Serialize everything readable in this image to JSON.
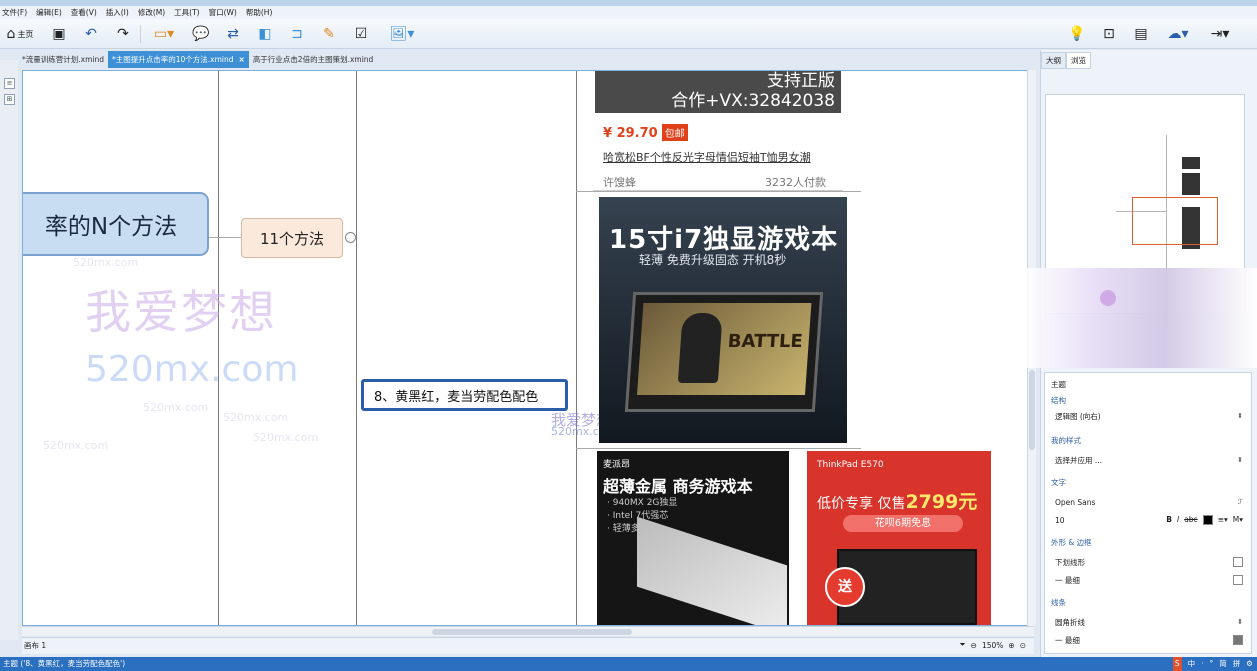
{
  "menu": [
    "文件(F)",
    "编辑(E)",
    "查看(V)",
    "插入(I)",
    "修改(M)",
    "工具(T)",
    "窗口(W)",
    "帮助(H)"
  ],
  "toolbar": {
    "home_label": "主页"
  },
  "tabs": [
    {
      "label": "*流量训练营计划.xmind",
      "active": false
    },
    {
      "label": "*主图提升点击率的10个方法.xmind",
      "active": true
    },
    {
      "label": "高于行业点击2倍的主图策划.xmind",
      "active": false
    }
  ],
  "mindmap": {
    "main_topic": "率的N个方法",
    "sub_topic": "11个方法",
    "selected_topic": "8、黄黑红，麦当劳配色配色"
  },
  "watermark": {
    "big_text": "我爱梦想",
    "url_text": "520mx.com",
    "small_text": "520mx.com",
    "small_big": "我爱梦想",
    "small_url": "520mx.com"
  },
  "product_top": {
    "banner_line1": "支持正版",
    "banner_line2": "合作+VX:32842038",
    "price": "¥ 29.70",
    "price_tag": "包邮",
    "title": "哈宽松BF个性反光字母情侣短袖T恤男女潮",
    "shop": "许馊蜂",
    "sold": "3232人付款"
  },
  "product_pubg": {
    "headline": "15寸i7独显游戏本",
    "sub": "轻薄 免费升级固态 开机8秒",
    "game_text": "BATTLE"
  },
  "product_black": {
    "logo": "麦派昂",
    "headline": "超薄金属 商务游戏本",
    "specs": [
      "· 940MX 2G独显",
      "· Intel 7代强芯",
      "· 轻薄多彩"
    ]
  },
  "product_red": {
    "brand": "ThinkPad E570",
    "headline_prefix": "低价专享 仅售",
    "price": "2799元",
    "pill": "花呗6期免息",
    "gift": "送"
  },
  "bottombar": {
    "sheet": "画布 1",
    "zoom": "150%"
  },
  "statusbar": {
    "text": "主题 ('8、黄黑红，麦当劳配色配色')",
    "ime": [
      "S",
      "中",
      "·",
      "°",
      "简",
      "拼",
      "⚙"
    ]
  },
  "right_panel": {
    "tabs": [
      "大纲",
      "浏览"
    ],
    "section_title": "主题",
    "structure_label": "结构",
    "structure_value": "逻辑图 (向右)",
    "mystyle_label": "我的样式",
    "mystyle_value": "选择并应用 ...",
    "text_label": "文字",
    "font_name": "Open Sans",
    "font_size": "10",
    "shape_label": "外形 & 边框",
    "shape_value": "下划线形",
    "border_value": "一 最细",
    "line_label": "线条",
    "line_value": "圆角折线",
    "line_width": "一 最细",
    "colors": {
      "accent": "#3d8fd6",
      "selected_border": "#2b5ea8",
      "main_fill": "#c9ddf2",
      "sub_fill": "#fbe9dc"
    }
  }
}
